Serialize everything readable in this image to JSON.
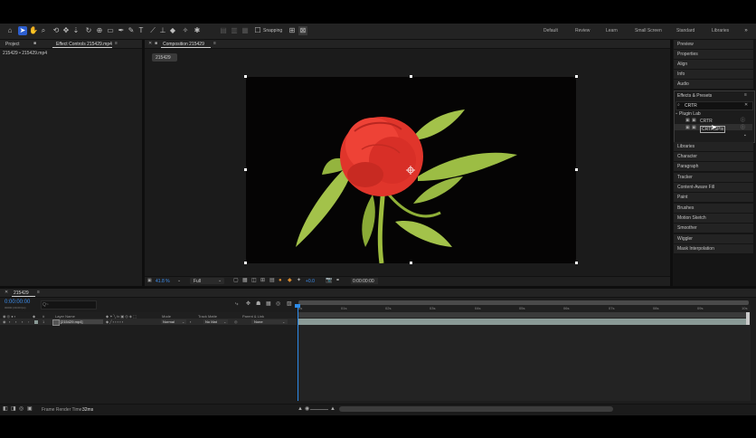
{
  "toolbar": {
    "snapping_label": "Snapping",
    "workspaces": [
      "Default",
      "Review",
      "Learn",
      "Small Screen",
      "Standard",
      "Libraries"
    ]
  },
  "left_panel": {
    "tab_project": "Project",
    "tab_effect_controls": "Effect Controls 215429.mp4",
    "breadcrumb": "215429 • 215429.mp4"
  },
  "composition": {
    "tab_label": "Composition 215429",
    "breadcrumb_chip": "215429",
    "zoom_value": "41.8 %",
    "resolution_value": "Full",
    "exposure_value": "+0.0",
    "timecode": "0:00:00:00"
  },
  "right_panel": {
    "top_items": [
      "Preview",
      "Properties",
      "Align",
      "Info",
      "Audio"
    ],
    "effects_title": "Effects & Presets",
    "search_value": "CRTR",
    "plugin_folder": "Plugin Lab",
    "plugin_items": [
      "CRTR",
      "CRTRSPix"
    ],
    "bottom_items": [
      "Libraries",
      "Character",
      "Paragraph",
      "Tracker",
      "Content-Aware Fill",
      "Paint",
      "Brushes",
      "Motion Sketch",
      "Smoother",
      "Wiggler",
      "Mask Interpolation"
    ]
  },
  "timeline": {
    "tab_label": "215429",
    "timecode": "0:00:00:00",
    "timecode_sub": "00000 (30.00 fps)",
    "search_placeholder": "Q~",
    "col_layer_name": "Layer Name",
    "col_mode": "Mode",
    "col_track_matte": "Track Matte",
    "col_parent_link": "Parent & Link",
    "layer_number": "1",
    "layer_name": "[215429.mp4]",
    "layer_mode": "Normal",
    "layer_matte": "No Mat",
    "layer_parent": "None",
    "ruler_labels": [
      "0s",
      "01s",
      "02s",
      "03s",
      "04s",
      "05s",
      "06s",
      "07s",
      "08s",
      "09s",
      "10s"
    ],
    "frame_render_label": "Frame Render Time:",
    "frame_render_value": "32ms"
  },
  "colors": {
    "accent": "#2d8ceb",
    "track_bar": "#8a9a96",
    "panel_bg": "#1d1d1d",
    "frame_bg": "#000000"
  }
}
